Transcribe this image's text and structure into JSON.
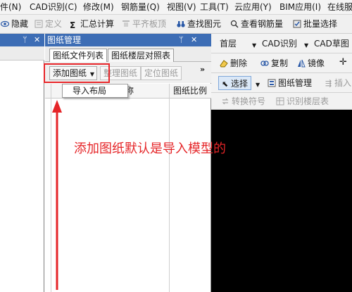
{
  "menubar": {
    "items": [
      "件(N)",
      "CAD识别(C)",
      "修改(M)",
      "钢筋量(Q)",
      "视图(V)",
      "工具(T)",
      "云应用(Y)",
      "BIM应用(I)",
      "在线服"
    ]
  },
  "toolbar": {
    "items": [
      {
        "label": "隐藏",
        "icon": "eye-icon",
        "disabled": false
      },
      {
        "label": "定义",
        "icon": "define-icon",
        "disabled": true
      },
      {
        "label": "汇总计算",
        "icon": "sigma-icon",
        "disabled": false
      },
      {
        "label": "平齐板顶",
        "icon": "align-top-icon",
        "disabled": true
      },
      {
        "label": "查找图元",
        "icon": "find-binoculars-icon",
        "disabled": false
      },
      {
        "label": "查看钢筋量",
        "icon": "view-rebar-icon",
        "disabled": false
      },
      {
        "label": "批量选择",
        "icon": "batch-select-icon",
        "disabled": false
      }
    ]
  },
  "drawing_panel": {
    "title": "图纸管理",
    "tabs": [
      "图纸文件列表",
      "图纸楼层对照表"
    ],
    "buttons": {
      "add_drawing": "添加图纸",
      "arrange_drawing": "整理图纸",
      "locate_drawing": "定位图纸"
    },
    "dropdown_item": "导入布局",
    "columns": [
      "称",
      "图纸比例"
    ]
  },
  "right_pane": {
    "row1": {
      "floor": "首层",
      "cad_identify": "CAD识别",
      "cad_drawing": "CAD草图"
    },
    "row2": {
      "delete": "删除",
      "copy": "复制",
      "mirror": "镜像"
    },
    "row3": {
      "select": "选择",
      "drawing_manage": "图纸管理",
      "insert": "插入"
    },
    "row4": {
      "convert_symbol": "转换符号",
      "identify_floor_table": "识别楼层表"
    }
  },
  "annotation": {
    "text": "添加图纸默认是导入模型的",
    "color": "#e52528"
  },
  "colors": {
    "panel_title": "#3d6db5",
    "highlight": "#e8262a",
    "canvas": "#000000"
  }
}
